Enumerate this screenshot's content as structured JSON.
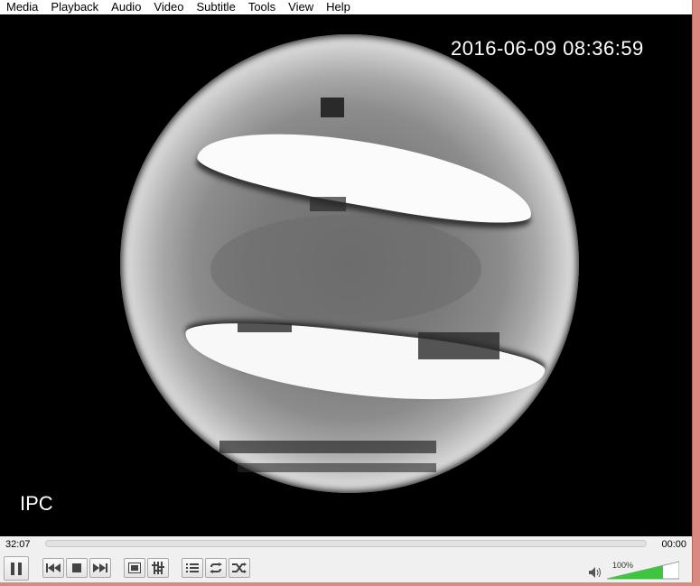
{
  "menu": [
    "Media",
    "Playback",
    "Audio",
    "Video",
    "Subtitle",
    "Tools",
    "View",
    "Help"
  ],
  "video": {
    "timestamp_overlay": "2016-06-09 08:36:59",
    "channel_label": "IPC"
  },
  "timeline": {
    "elapsed": "32:07",
    "total": "00:00"
  },
  "controls": {
    "buttons": [
      "pause-icon",
      "previous-icon",
      "stop-icon",
      "next-icon",
      "fullscreen-icon",
      "extended-settings-icon",
      "playlist-icon",
      "loop-icon",
      "shuffle-icon"
    ]
  },
  "volume": {
    "label": "100%",
    "level": 1.0,
    "accent": "#3fc43f"
  }
}
